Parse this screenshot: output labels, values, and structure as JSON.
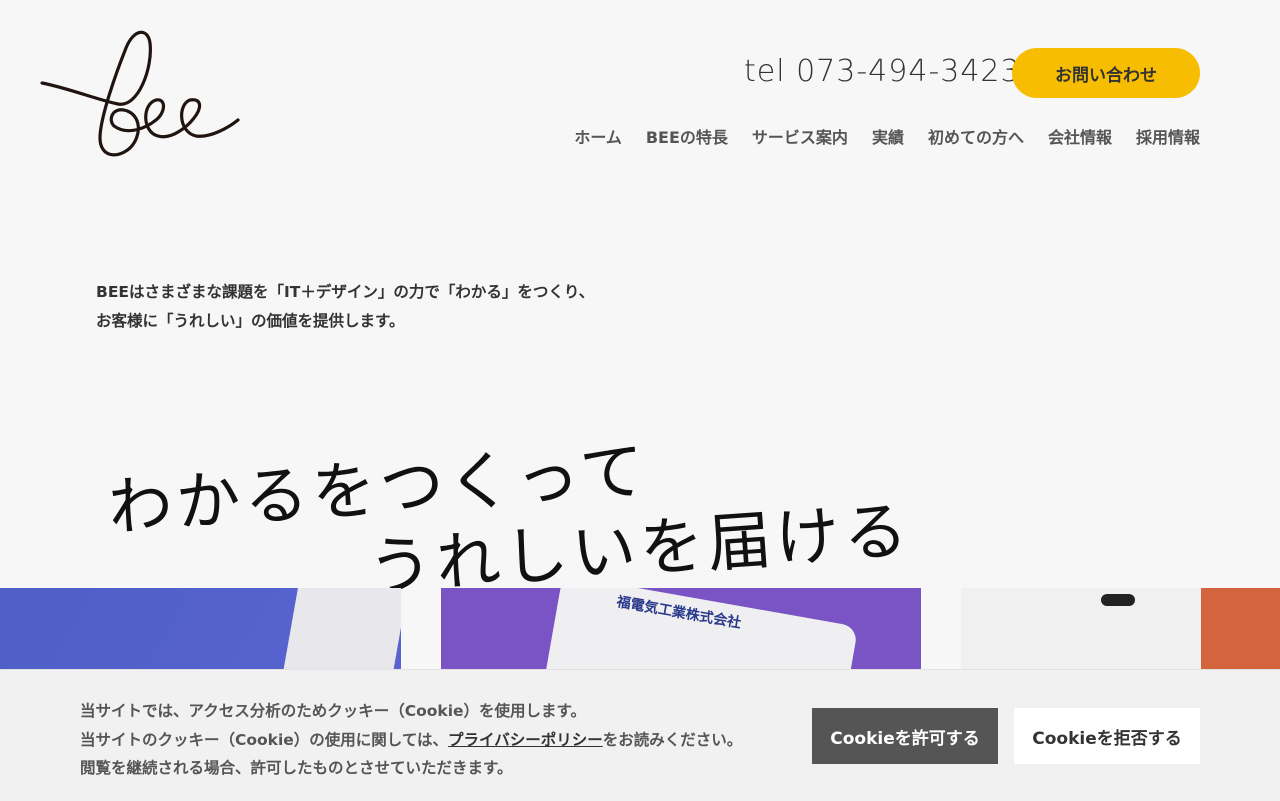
{
  "header": {
    "tel": "tel 073-494-3423",
    "contact_label": "お問い合わせ",
    "nav": [
      "ホーム",
      "BEEの特長",
      "サービス案内",
      "実績",
      "初めての方へ",
      "会社情報",
      "採用情報"
    ]
  },
  "hero": {
    "intro_line1": "BEEはさまざまな課題を「IT＋デザイン」の力で「わかる」をつくり、",
    "intro_line2": "お客様に「うれしい」の価値を提供します。",
    "handwritten_line1": "わかるをつくって",
    "handwritten_line2": "うれしいを届ける"
  },
  "cards": {
    "card2_company": "福電気工業株式会社"
  },
  "cookie": {
    "line1": "当サイトでは、アクセス分析のためクッキー（Cookie）を使用します。",
    "line2_prefix": "当サイトのクッキー（Cookie）の使用に関しては、",
    "line2_link": "プライバシーポリシー",
    "line2_suffix": "をお読みください。",
    "line3": "閲覧を継続される場合、許可したものとさせていただきます。",
    "accept_label": "Cookieを許可する",
    "reject_label": "Cookieを拒否する"
  },
  "colors": {
    "accent": "#f7bd00",
    "card1": "#4e5fc8",
    "card2": "#7a53c4",
    "card3": "#d4643e"
  }
}
